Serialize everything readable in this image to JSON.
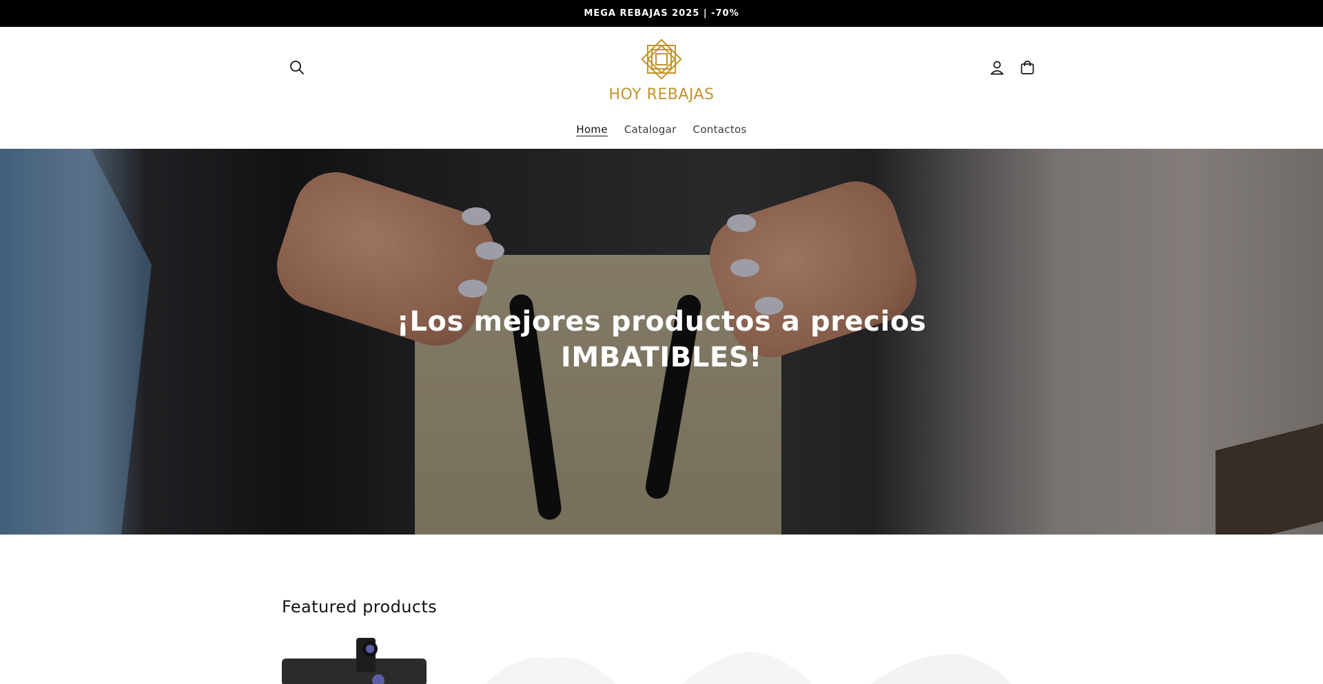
{
  "announcement": {
    "text": "MEGA REBAJAS 2025 | -70%"
  },
  "header": {
    "logo_text": "HOY REBAJAS",
    "brand_color": "#c1932c",
    "icons": {
      "search": "search-icon",
      "account": "user-icon",
      "cart": "cart-icon"
    }
  },
  "nav": {
    "items": [
      {
        "label": "Home",
        "active": true
      },
      {
        "label": "Catalogar",
        "active": false
      },
      {
        "label": "Contactos",
        "active": false
      }
    ]
  },
  "hero": {
    "title_line1": "¡Los mejores productos a precios",
    "title_line2": "IMBATIBLES!"
  },
  "featured": {
    "title": "Featured products"
  }
}
